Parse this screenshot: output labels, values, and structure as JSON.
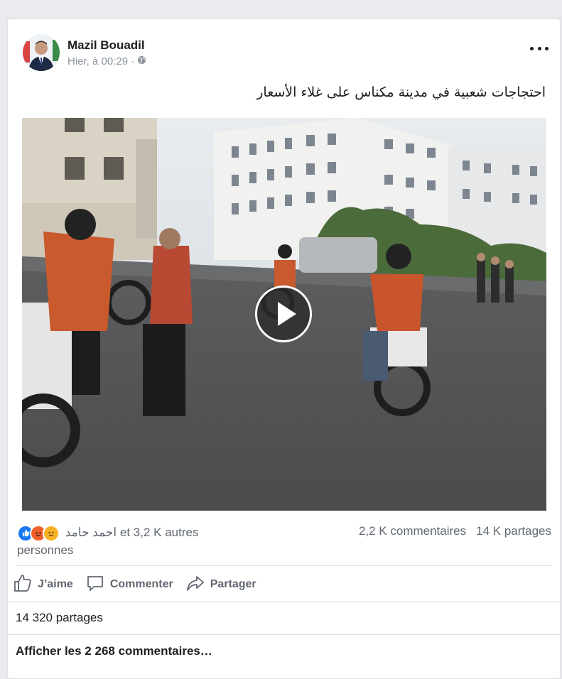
{
  "post": {
    "author": "Mazil Bouadil",
    "time": "Hier, à 00:29 ·",
    "privacy_icon": "globe-icon",
    "text": "احتجاجات شعبية في مدينة مكناس على غلاء الأسعار"
  },
  "reactions": {
    "icons": [
      "like-icon",
      "angry-icon",
      "sad-icon"
    ],
    "summary": "احمد حامد et 3,2 K autres personnes",
    "comments": "2,2 K commentaires",
    "shares": "14 K partages"
  },
  "actions": {
    "like": "J’aime",
    "comment": "Commenter",
    "share": "Partager"
  },
  "footer": {
    "shares_count": "14 320 partages",
    "view_comments": "Afficher les 2 268 commentaires…"
  },
  "colors": {
    "like_blue": "#1877f2",
    "angry_orange": "#f0602a",
    "sad_yellow": "#f7b125",
    "text_secondary": "#606770"
  }
}
